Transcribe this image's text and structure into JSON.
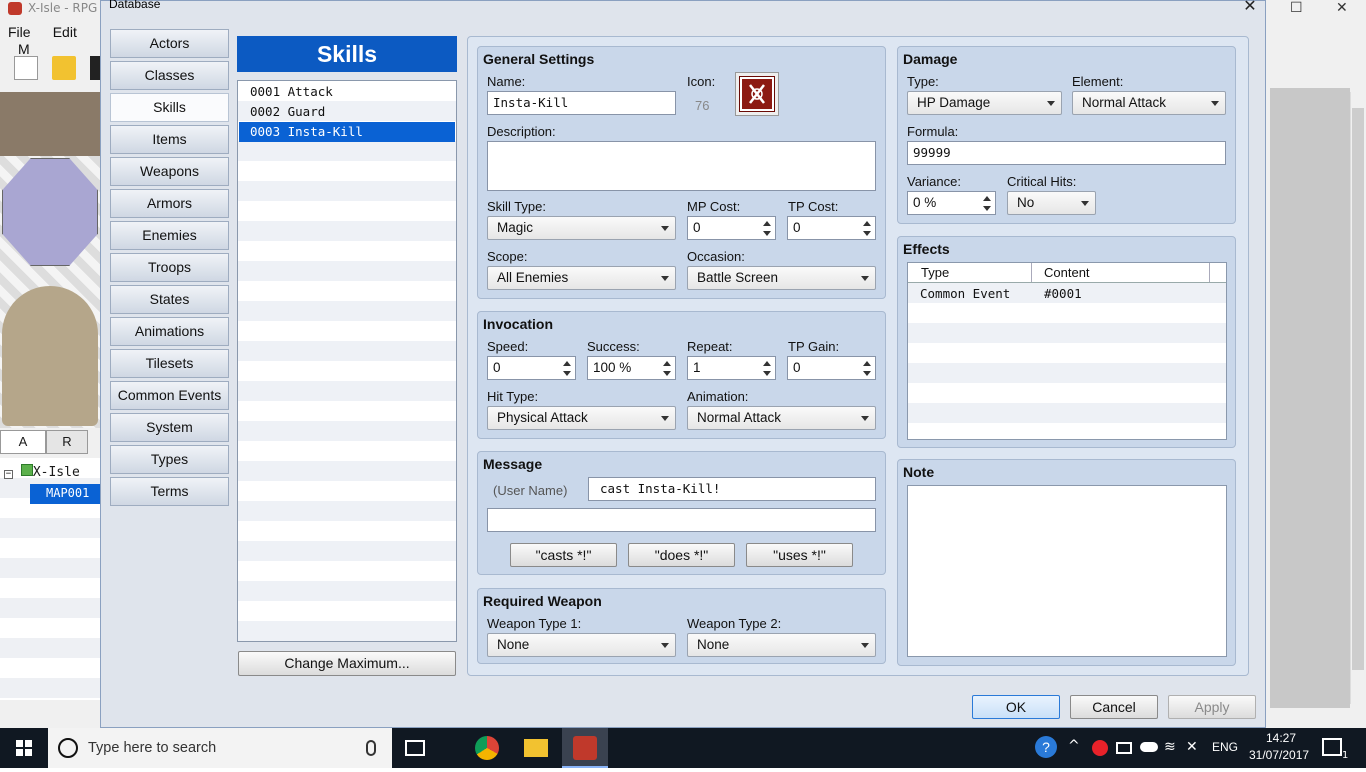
{
  "background_app": {
    "title": "X-Isle - RPG M",
    "menu": [
      "File",
      "Edit",
      "M"
    ],
    "tileset_tabs": [
      "A",
      "R"
    ],
    "map_tree": {
      "root": "X-Isle",
      "map": "MAP001"
    }
  },
  "dialog": {
    "title": "Database",
    "close": "✕",
    "categories": [
      "Actors",
      "Classes",
      "Skills",
      "Items",
      "Weapons",
      "Armors",
      "Enemies",
      "Troops",
      "States",
      "Animations",
      "Tilesets",
      "Common Events",
      "System",
      "Types",
      "Terms"
    ],
    "selected_category": "Skills",
    "list_header": "Skills",
    "list_items": [
      "0001 Attack",
      "0002 Guard",
      "0003 Insta-Kill"
    ],
    "selected_item": "0003 Insta-Kill",
    "change_max_label": "Change Maximum...",
    "general": {
      "title": "General Settings",
      "name_label": "Name:",
      "name_value": "Insta-Kill",
      "icon_label": "Icon:",
      "icon_index": "76",
      "description_label": "Description:",
      "description_value": "",
      "skill_type_label": "Skill Type:",
      "skill_type_value": "Magic",
      "mp_cost_label": "MP Cost:",
      "mp_cost_value": "0",
      "tp_cost_label": "TP Cost:",
      "tp_cost_value": "0",
      "scope_label": "Scope:",
      "scope_value": "All Enemies",
      "occasion_label": "Occasion:",
      "occasion_value": "Battle Screen"
    },
    "invocation": {
      "title": "Invocation",
      "speed_label": "Speed:",
      "speed_value": "0",
      "success_label": "Success:",
      "success_value": "100 %",
      "repeat_label": "Repeat:",
      "repeat_value": "1",
      "tp_gain_label": "TP Gain:",
      "tp_gain_value": "0",
      "hit_type_label": "Hit Type:",
      "hit_type_value": "Physical Attack",
      "animation_label": "Animation:",
      "animation_value": "Normal Attack"
    },
    "message": {
      "title": "Message",
      "user_name": "(User Name)",
      "line1": "cast Insta-Kill!",
      "line2": "",
      "btn_casts": "\"casts *!\"",
      "btn_does": "\"does *!\"",
      "btn_uses": "\"uses *!\""
    },
    "required_weapon": {
      "title": "Required Weapon",
      "wt1_label": "Weapon Type 1:",
      "wt1_value": "None",
      "wt2_label": "Weapon Type 2:",
      "wt2_value": "None"
    },
    "damage": {
      "title": "Damage",
      "type_label": "Type:",
      "type_value": "HP Damage",
      "element_label": "Element:",
      "element_value": "Normal Attack",
      "formula_label": "Formula:",
      "formula_value": "99999",
      "variance_label": "Variance:",
      "variance_value": "0 %",
      "critical_label": "Critical Hits:",
      "critical_value": "No"
    },
    "effects": {
      "title": "Effects",
      "col_type": "Type",
      "col_content": "Content",
      "rows": [
        {
          "type": "Common Event",
          "content": "#0001"
        }
      ]
    },
    "note": {
      "title": "Note",
      "value": ""
    },
    "footer": {
      "ok": "OK",
      "cancel": "Cancel",
      "apply": "Apply"
    }
  },
  "taskbar": {
    "search_placeholder": "Type here to search",
    "lang": "ENG",
    "time": "14:27",
    "date": "31/07/2017",
    "notification_count": "1"
  },
  "colors": {
    "accent": "#0c5ac2",
    "selection": "#0a62d4",
    "group_bg": "#c9d7ea",
    "taskbar": "#101822"
  }
}
